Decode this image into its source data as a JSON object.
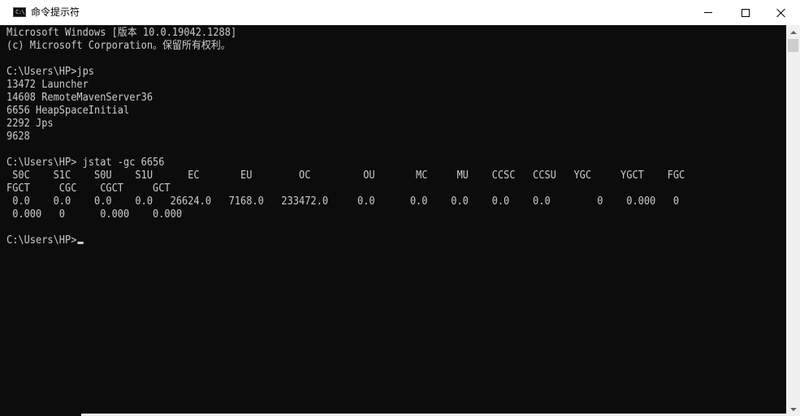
{
  "window": {
    "title": "命令提示符",
    "icon_label": "C:\\"
  },
  "titlebar_buttons": {
    "minimize": "minimize-icon",
    "maximize": "maximize-icon",
    "close": "close-icon"
  },
  "console": {
    "lines": [
      "Microsoft Windows [版本 10.0.19042.1288]",
      "(c) Microsoft Corporation。保留所有权利。",
      "",
      "C:\\Users\\HP>jps",
      "13472 Launcher",
      "14608 RemoteMavenServer36",
      "6656 HeapSpaceInitial",
      "2292 Jps",
      "9628",
      "",
      "C:\\Users\\HP> jstat -gc 6656",
      " S0C    S1C    S0U    S1U      EC       EU        OC         OU       MC     MU    CCSC   CCSU   YGC     YGCT    FGC",
      "FGCT     CGC    CGCT     GCT",
      " 0.0    0.0    0.0    0.0   26624.0   7168.0   233472.0     0.0      0.0    0.0    0.0    0.0        0    0.000   0",
      " 0.000   0      0.000    0.000",
      "",
      "C:\\Users\\HP>"
    ]
  },
  "colors": {
    "console_bg": "#0c0c0c",
    "console_fg": "#cccccc",
    "titlebar_bg": "#ffffff",
    "scrollbar_bg": "#f0f0f0"
  }
}
